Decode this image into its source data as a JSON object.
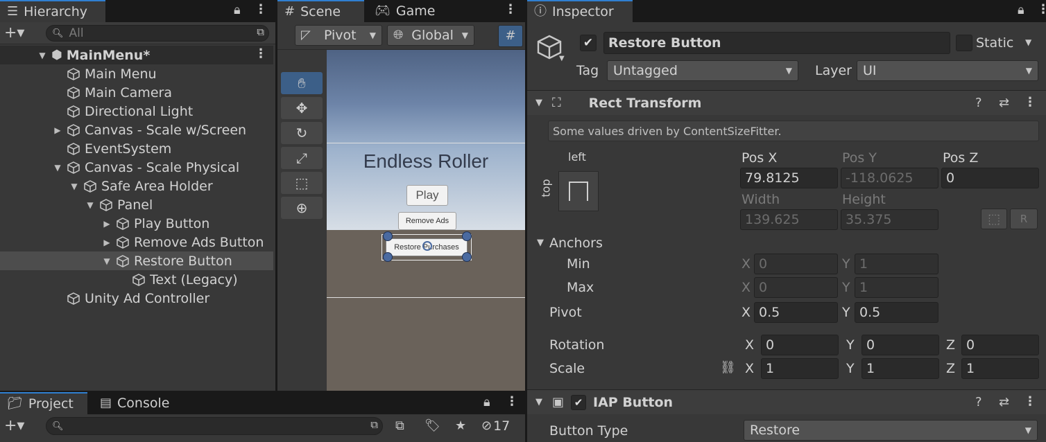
{
  "hierarchy": {
    "tab_label": "Hierarchy",
    "search_placeholder": "All",
    "scene_name": "MainMenu*",
    "items": [
      {
        "label": "Main Menu"
      },
      {
        "label": "Main Camera"
      },
      {
        "label": "Directional Light"
      },
      {
        "label": "Canvas - Scale w/Screen"
      },
      {
        "label": "EventSystem"
      },
      {
        "label": "Canvas - Scale Physical"
      },
      {
        "label": "Safe Area Holder"
      },
      {
        "label": "Panel"
      },
      {
        "label": "Play Button"
      },
      {
        "label": "Remove Ads Button"
      },
      {
        "label": "Restore Button"
      },
      {
        "label": "Text (Legacy)"
      },
      {
        "label": "Unity Ad Controller"
      }
    ]
  },
  "scene": {
    "tab_scene": "Scene",
    "tab_game": "Game",
    "pivot_label": "Pivot",
    "global_label": "Global",
    "game_title": "Endless Roller",
    "play_label": "Play",
    "remove_ads_label": "Remove Ads",
    "restore_label": "Restore Purchases"
  },
  "project": {
    "tab_project": "Project",
    "tab_console": "Console",
    "hidden_count": "17"
  },
  "inspector": {
    "tab_label": "Inspector",
    "object_name": "Restore Button",
    "static_label": "Static",
    "tag_label": "Tag",
    "tag_value": "Untagged",
    "layer_label": "Layer",
    "layer_value": "UI",
    "rect_transform": {
      "title": "Rect Transform",
      "note": "Some values driven by ContentSizeFitter.",
      "anchor_h": "left",
      "anchor_v": "top",
      "pos_x_label": "Pos X",
      "pos_y_label": "Pos Y",
      "pos_z_label": "Pos Z",
      "pos_x": "79.8125",
      "pos_y": "-118.0625",
      "pos_z": "0",
      "width_label": "Width",
      "height_label": "Height",
      "width": "139.625",
      "height": "35.375",
      "r_button": "R",
      "anchors_label": "Anchors",
      "min_label": "Min",
      "max_label": "Max",
      "min_x": "0",
      "min_y": "1",
      "max_x": "0",
      "max_y": "1",
      "pivot_label": "Pivot",
      "pivot_x": "0.5",
      "pivot_y": "0.5",
      "rotation_label": "Rotation",
      "rot_x": "0",
      "rot_y": "0",
      "rot_z": "0",
      "scale_label": "Scale",
      "scale_x": "1",
      "scale_y": "1",
      "scale_z": "1",
      "x": "X",
      "y": "Y",
      "z": "Z"
    },
    "iap_button": {
      "title": "IAP Button",
      "button_type_label": "Button Type",
      "button_type_value": "Restore"
    }
  },
  "colors": {
    "accent": "#2f7fd1",
    "panel": "#383838",
    "selection": "#4d4d4d"
  }
}
